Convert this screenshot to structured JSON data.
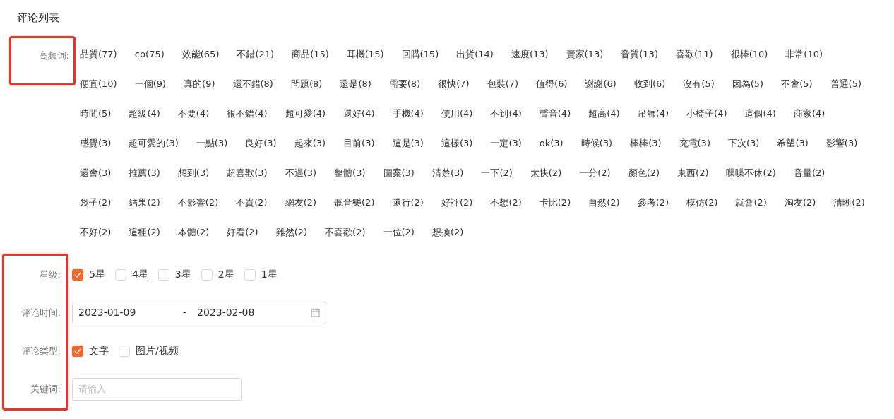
{
  "title": "评论列表",
  "keywords": {
    "label": "高频词:",
    "highlighted": true,
    "items": [
      "品質(77)",
      "cp(75)",
      "效能(65)",
      "不錯(21)",
      "商品(15)",
      "耳機(15)",
      "回購(15)",
      "出貨(14)",
      "速度(13)",
      "賣家(13)",
      "音質(13)",
      "喜歡(11)",
      "很棒(10)",
      "非常(10)",
      "便宜(10)",
      "一個(9)",
      "真的(9)",
      "還不錯(8)",
      "問題(8)",
      "還是(8)",
      "需要(8)",
      "很快(7)",
      "包裝(7)",
      "值得(6)",
      "謝謝(6)",
      "收到(6)",
      "沒有(5)",
      "因為(5)",
      "不會(5)",
      "普通(5)",
      "時間(5)",
      "超級(4)",
      "不要(4)",
      "很不錯(4)",
      "超可愛(4)",
      "還好(4)",
      "手機(4)",
      "使用(4)",
      "不到(4)",
      "聲音(4)",
      "超高(4)",
      "吊飾(4)",
      "小椅子(4)",
      "這個(4)",
      "商家(4)",
      "感覺(3)",
      "超可愛的(3)",
      "一點(3)",
      "良好(3)",
      "起來(3)",
      "目前(3)",
      "這是(3)",
      "這樣(3)",
      "一定(3)",
      "ok(3)",
      "時候(3)",
      "棒棒(3)",
      "充電(3)",
      "下次(3)",
      "希望(3)",
      "影響(3)",
      "還會(3)",
      "推薦(3)",
      "想到(3)",
      "超喜歡(3)",
      "不過(3)",
      "整體(3)",
      "圖案(3)",
      "清楚(3)",
      "一下(2)",
      "太快(2)",
      "一分(2)",
      "顏色(2)",
      "東西(2)",
      "喋喋不休(2)",
      "音量(2)",
      "袋子(2)",
      "結果(2)",
      "不影響(2)",
      "不貴(2)",
      "網友(2)",
      "聽音樂(2)",
      "還行(2)",
      "好評(2)",
      "不想(2)",
      "卡比(2)",
      "自然(2)",
      "參考(2)",
      "模仿(2)",
      "就會(2)",
      "淘友(2)",
      "清晰(2)",
      "不好(2)",
      "這種(2)",
      "本體(2)",
      "好看(2)",
      "雖然(2)",
      "不喜歡(2)",
      "一位(2)",
      "想換(2)"
    ]
  },
  "filters": {
    "highlighted": true,
    "rows": [
      {
        "kind": "checkboxes",
        "label": "星级:",
        "options": [
          {
            "label": "5星",
            "checked": true
          },
          {
            "label": "4星",
            "checked": false
          },
          {
            "label": "3星",
            "checked": false
          },
          {
            "label": "2星",
            "checked": false
          },
          {
            "label": "1星",
            "checked": false
          }
        ]
      },
      {
        "kind": "daterange",
        "label": "评论时间:",
        "start": "2023-01-09",
        "separator": "-",
        "end": "2023-02-08"
      },
      {
        "kind": "checkboxes",
        "label": "评论类型:",
        "options": [
          {
            "label": "文字",
            "checked": true
          },
          {
            "label": "图片/视频",
            "checked": false
          }
        ]
      },
      {
        "kind": "input",
        "label": "关键词:",
        "placeholder": "请输入"
      }
    ]
  }
}
